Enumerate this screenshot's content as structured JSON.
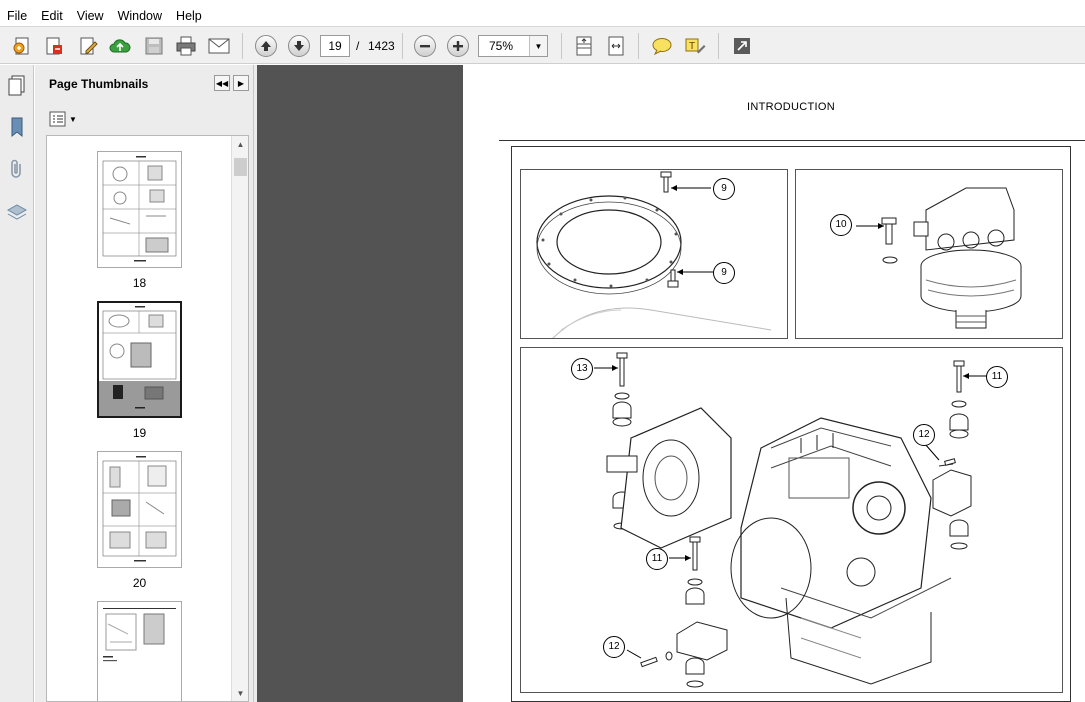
{
  "menu": [
    "File",
    "Edit",
    "View",
    "Window",
    "Help"
  ],
  "toolbar": {
    "page_current": "19",
    "page_separator": "/",
    "page_total": "1423",
    "zoom": "75%"
  },
  "panel": {
    "title": "Page Thumbnails",
    "thumbnails": [
      {
        "label": "18"
      },
      {
        "label": "19"
      },
      {
        "label": "20"
      },
      {
        "label": ""
      }
    ]
  },
  "document": {
    "heading": "INTRODUCTION",
    "callouts": {
      "c9a": "9",
      "c9b": "9",
      "c10": "10",
      "c13": "13",
      "c11a": "11",
      "c12a": "12",
      "c11b": "11",
      "c12b": "12"
    }
  },
  "colors": {
    "toolbar_bg": "#f0f0f0",
    "document_bg": "#535353",
    "panel_bg": "#ececec",
    "selected_thumb": "#1a1a1a"
  }
}
